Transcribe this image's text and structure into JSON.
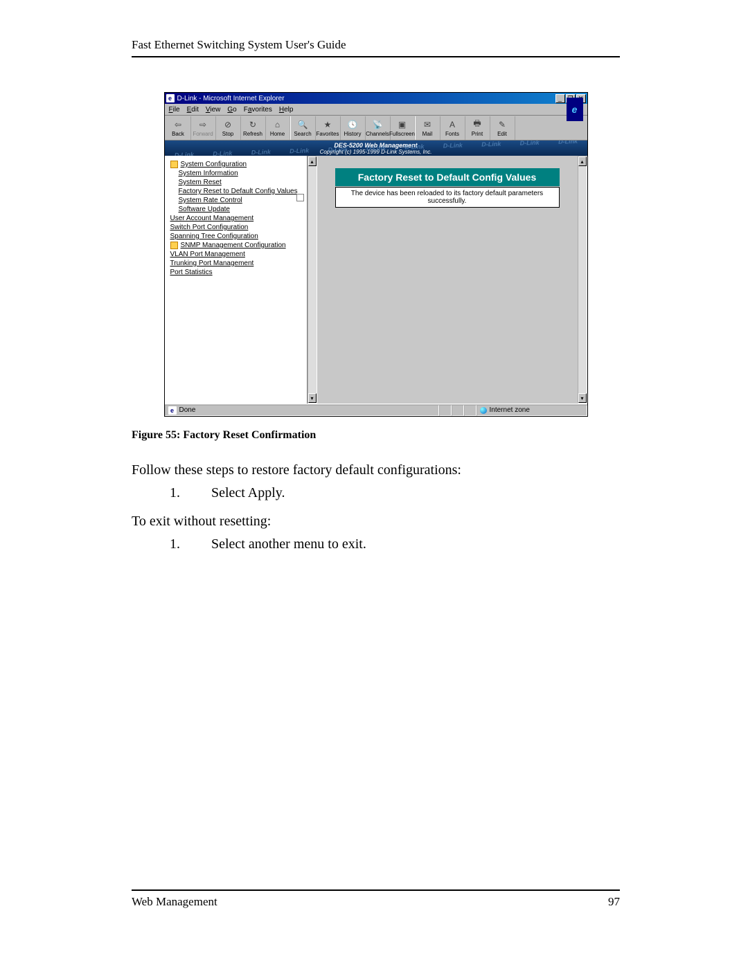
{
  "doc": {
    "running_head": "Fast Ethernet Switching System User's Guide",
    "figure_caption": "Figure 55: Factory Reset Confirmation",
    "para1": "Follow these steps to restore factory default configurations:",
    "step1_num": "1.",
    "step1_text": "Select Apply.",
    "para2": "To exit without resetting:",
    "step2_num": "1.",
    "step2_text": "Select another menu to exit.",
    "footer_left": "Web Management",
    "footer_right": "97"
  },
  "window": {
    "title": "D-Link - Microsoft Internet Explorer",
    "menus": {
      "file": "File",
      "edit": "Edit",
      "view": "View",
      "go": "Go",
      "favorites": "Favorites",
      "help": "Help"
    },
    "toolbar": {
      "back": "Back",
      "forward": "Forward",
      "stop": "Stop",
      "refresh": "Refresh",
      "home": "Home",
      "search": "Search",
      "favorites": "Favorites",
      "history": "History",
      "channels": "Channels",
      "fullscreen": "Fullscreen",
      "mail": "Mail",
      "fonts": "Fonts",
      "print": "Print",
      "edit": "Edit"
    },
    "banner": {
      "title": "DES-5200 Web Management",
      "copyright": "Copyright (c) 1995-1999 D-Link Systems, Inc.",
      "watermark": "D-Link"
    },
    "tree": {
      "sys_config": "System Configuration",
      "sys_info": "System Information",
      "sys_reset": "System Reset",
      "factory_reset": "Factory Reset to Default Config Values",
      "rate_control": "System Rate Control",
      "sw_update": "Software Update",
      "user_acct": "User Account Management",
      "switch_port": "Switch Port Configuration",
      "spanning": "Spanning Tree Configuration",
      "snmp": "SNMP Management Configuration",
      "vlan": "VLAN Port Management",
      "trunking": "Trunking Port Management",
      "port_stats": "Port Statistics"
    },
    "main": {
      "header": "Factory Reset to Default Config Values",
      "message": "The device has been reloaded to its factory default parameters successfully."
    },
    "status": {
      "done": "Done",
      "zone": "Internet zone"
    }
  }
}
